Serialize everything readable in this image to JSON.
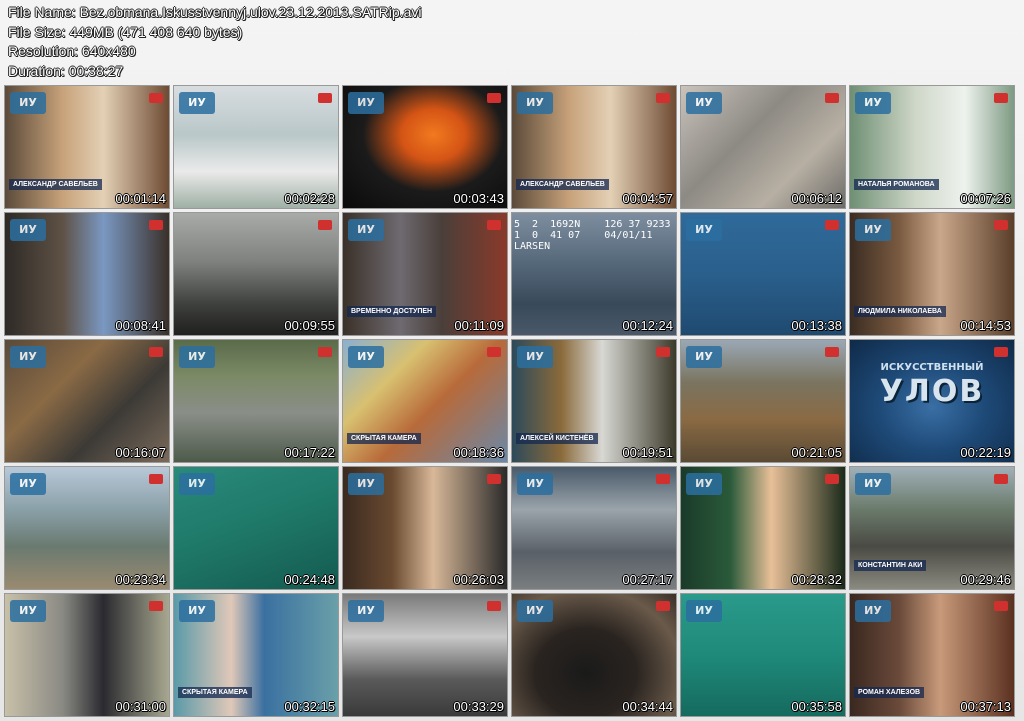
{
  "file_info": {
    "file_name": "File Name: Bez.obmana.Iskusstvennyj.ulov.23.12.2013.SATRip.avi",
    "file_size": "File Size: 449MB (471 408 640 bytes)",
    "resolution": "Resolution: 640x480",
    "duration": "Duration: 00:38:27"
  },
  "thumbnails": [
    {
      "time": "00:01:14",
      "bg": "linear-gradient(90deg,#5b4a3a 0%,#c7a27a 35%,#e3d0b5 60%,#6e4b33 100%)",
      "caption": "АЛЕКСАНДР САВЕЛЬЕВ",
      "logo": "ИУ",
      "chan": true
    },
    {
      "time": "00:02:28",
      "bg": "linear-gradient(180deg,#d8dde0 0%,#b9c7c8 40%,#eaeaea 70%,#9fb0a5 100%)",
      "logo": "ИУ",
      "chan": true
    },
    {
      "time": "00:03:43",
      "bg": "radial-gradient(ellipse at 55% 40%,#f27a1f 0%,#d45415 25%,#1b1b1b 55%,#0a0a0a 100%)",
      "logo": "ИУ",
      "chan": true
    },
    {
      "time": "00:04:57",
      "bg": "linear-gradient(90deg,#5b4a3a 0%,#c7a27a 35%,#e3d0b5 60%,#6e4b33 100%)",
      "caption": "АЛЕКСАНДР САВЕЛЬЕВ",
      "logo": "ИУ",
      "chan": true
    },
    {
      "time": "00:06:12",
      "bg": "linear-gradient(135deg,#c9c3bb 0%,#8d8a84 40%,#b7afa3 70%,#6d6c68 100%)",
      "logo": "ИУ",
      "chan": true
    },
    {
      "time": "00:07:26",
      "bg": "linear-gradient(90deg,#6f8f74 0%,#cfd7c8 40%,#eef2ee 70%,#7d9a82 100%)",
      "caption": "НАТАЛЬЯ РОМАНОВА",
      "logo": "ИУ",
      "chan": true
    },
    {
      "time": "00:08:41",
      "bg": "linear-gradient(90deg,#2e2a26 0%,#5e5145 35%,#7a98c2 60%,#3a3029 100%)",
      "logo": "ИУ",
      "chan": true
    },
    {
      "time": "00:09:55",
      "bg": "linear-gradient(180deg,#a8aba8 0%,#7f817e 40%,#3e403d 75%,#1f201f 100%)",
      "logo": "",
      "chan": true
    },
    {
      "time": "00:11:09",
      "bg": "linear-gradient(90deg,#3a3028 0%,#6e6a70 35%,#4a3f3a 60%,#8a3a2a 100%)",
      "caption": "ВРЕМЕННО ДОСТУПЕН",
      "logo": "ИУ",
      "chan": true
    },
    {
      "time": "00:12:24",
      "bg": "linear-gradient(180deg,#7e8ea0 0%,#56697a 40%,#384a5a 75%,#4a5868 100%)",
      "osd": "5  2  1692N    126 37 9233\n1  0  41 07    04/01/11\nLARSEN",
      "logo": "",
      "chan": false
    },
    {
      "time": "00:13:38",
      "bg": "linear-gradient(180deg,#2f6a9a 0%,#2a5f8c 50%,#1f4a70 100%)",
      "logo": "ИУ",
      "chan": true
    },
    {
      "time": "00:14:53",
      "bg": "linear-gradient(90deg,#3a2c22 0%,#7a5a40 30%,#c9a78a 55%,#5a3e2a 100%)",
      "caption": "ЛЮДМИЛА НИКОЛАЕВА",
      "logo": "ИУ",
      "chan": true
    },
    {
      "time": "00:16:07",
      "bg": "linear-gradient(135deg,#5a4a3a 0%,#8a6a45 35%,#3c3a36 65%,#7a6a5a 100%)",
      "logo": "ИУ",
      "chan": true
    },
    {
      "time": "00:17:22",
      "bg": "linear-gradient(180deg,#5a6b4a 0%,#7c8a66 30%,#8a8e88 60%,#4d5a4a 100%)",
      "logo": "ИУ",
      "chan": true
    },
    {
      "time": "00:18:36",
      "bg": "linear-gradient(135deg,#8ab0d0 0%,#d8c070 30%,#b86a3a 55%,#6a88a8 100%)",
      "caption": "СКРЫТАЯ КАМЕРА",
      "logo": "ИУ",
      "chan": true
    },
    {
      "time": "00:19:51",
      "bg": "linear-gradient(90deg,#2c4a5a 0%,#8a6a3a 30%,#d8d8d4 55%,#3c3a2a 100%)",
      "caption": "АЛЕКСЕЙ КИСТЕНЁВ",
      "logo": "ИУ",
      "chan": true
    },
    {
      "time": "00:21:05",
      "bg": "linear-gradient(180deg,#9aa8b5 0%,#7a7460 35%,#8a6a44 65%,#5a4a34 100%)",
      "logo": "ИУ",
      "chan": true
    },
    {
      "time": "00:22:19",
      "bg": "radial-gradient(ellipse at 50% 55%,#3a6fa5 0%,#1e4a78 45%,#0f2a48 100%)",
      "big": "УЛОВ",
      "small": "ИСКУССТВЕННЫЙ",
      "logo": "",
      "chan": true
    },
    {
      "time": "00:23:34",
      "bg": "linear-gradient(180deg,#b8c8d8 0%,#8aa0a8 35%,#6a7a70 65%,#9a8a70 100%)",
      "logo": "ИУ",
      "chan": true
    },
    {
      "time": "00:24:48",
      "bg": "linear-gradient(160deg,#2a8a7a 0%,#1f7a6a 45%,#145a50 100%)",
      "logo": "ИУ",
      "chan": false
    },
    {
      "time": "00:26:03",
      "bg": "linear-gradient(90deg,#3a2a20 0%,#6a4a30 30%,#d8b898 55%,#2a2a2a 100%)",
      "logo": "ИУ",
      "chan": true
    },
    {
      "time": "00:27:17",
      "bg": "linear-gradient(180deg,#4a5a6a 0%,#9aa4aa 35%,#5a6068 70%,#7a7e80 100%)",
      "logo": "ИУ",
      "chan": true
    },
    {
      "time": "00:28:32",
      "bg": "linear-gradient(90deg,#1a3a2a 0%,#2a5a3a 30%,#e8c098 55%,#1a2a1a 100%)",
      "logo": "ИУ",
      "chan": true
    },
    {
      "time": "00:29:46",
      "bg": "linear-gradient(180deg,#a0b0b8 0%,#6a7a6a 35%,#4a4a44 65%,#8a8a80 100%)",
      "caption": "КОНСТАНТИН АКИ",
      "logo": "ИУ",
      "chan": true
    },
    {
      "time": "00:31:00",
      "bg": "linear-gradient(90deg,#c8c0a8 0%,#8a8a84 35%,#2a2a30 60%,#a8a890 100%)",
      "logo": "ИУ",
      "chan": true
    },
    {
      "time": "00:32:15",
      "bg": "linear-gradient(90deg,#5a9aa8 0%,#e0c8b8 35%,#3a70a0 55%,#6aa0a8 100%)",
      "caption": "СКРЫТАЯ КАМЕРА",
      "logo": "ИУ",
      "chan": false
    },
    {
      "time": "00:33:29",
      "bg": "linear-gradient(180deg,#7a7a7a 0%,#c8c8c8 35%,#5a5a5a 70%,#3a3a3a 100%)",
      "logo": "ИУ",
      "chan": true
    },
    {
      "time": "00:34:44",
      "bg": "radial-gradient(ellipse at 45% 65%,#1a1a1a 0%,#2a2420 40%,#6a5a4a 75%,#3a3028 100%)",
      "logo": "ИУ",
      "chan": true
    },
    {
      "time": "00:35:58",
      "bg": "linear-gradient(180deg,#2a9a8a 0%,#1f8a7a 50%,#156a5e 100%)",
      "logo": "ИУ",
      "chan": false
    },
    {
      "time": "00:37:13",
      "bg": "linear-gradient(90deg,#3a2820 0%,#6a4a3a 30%,#c89a7a 55%,#5a3020 100%)",
      "caption": "РОМАН ХАЛЕЗОВ",
      "logo": "ИУ",
      "chan": true
    }
  ]
}
